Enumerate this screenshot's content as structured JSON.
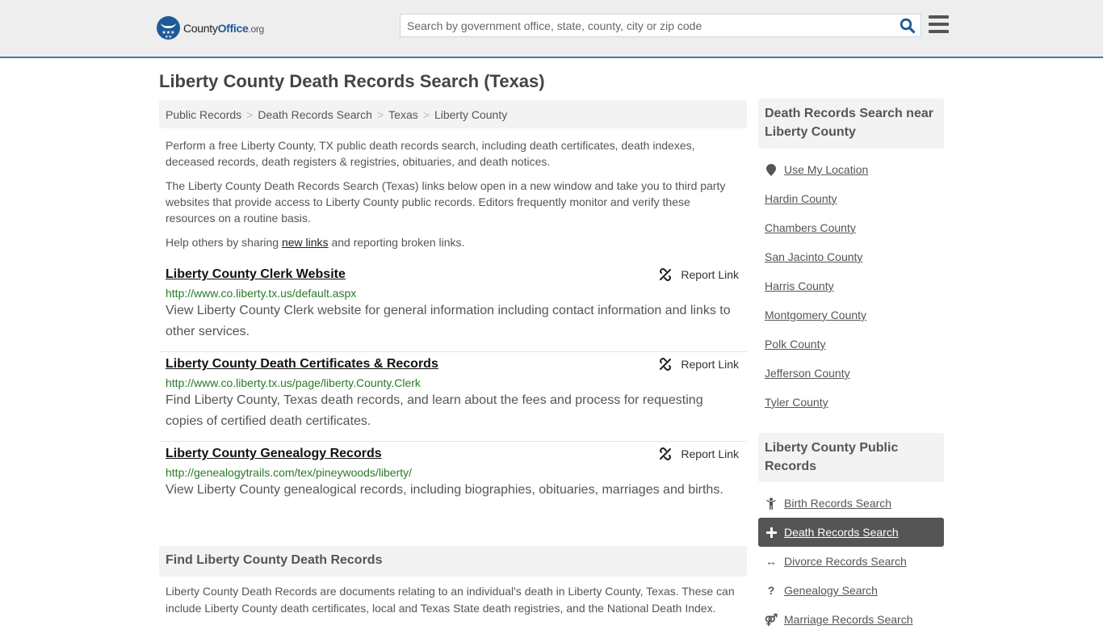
{
  "header": {
    "logo": {
      "prefix": "County",
      "brand": "Office",
      "tld": ".org"
    },
    "search": {
      "placeholder": "Search by government office, state, county, city or zip code",
      "value": ""
    },
    "colors": {
      "brand": "#1e5a99",
      "header_border": "#3a7fb0"
    }
  },
  "page": {
    "title": "Liberty County Death Records Search (Texas)",
    "breadcrumb": [
      {
        "label": "Public Records"
      },
      {
        "label": "Death Records Search"
      },
      {
        "label": "Texas"
      },
      {
        "label": "Liberty County"
      }
    ],
    "breadcrumb_separator": ">",
    "intro": {
      "p1": "Perform a free Liberty County, TX public death records search, including death certificates, death indexes, deceased records, death registers & registries, obituaries, and death notices.",
      "p2": "The Liberty County Death Records Search (Texas) links below open in a new window and take you to third party websites that provide access to Liberty County public records. Editors frequently monitor and verify these resources on a routine basis.",
      "p3_before": "Help others by sharing ",
      "p3_link": "new links",
      "p3_after": " and reporting broken links."
    },
    "links": [
      {
        "title": "Liberty County Clerk Website",
        "url": "http://www.co.liberty.tx.us/default.aspx",
        "description": "View Liberty County Clerk website for general information including contact information and links to other services.",
        "report_label": "Report Link"
      },
      {
        "title": "Liberty County Death Certificates & Records",
        "url": "http://www.co.liberty.tx.us/page/liberty.County.Clerk",
        "description": "Find Liberty County, Texas death records, and learn about the fees and process for requesting copies of certified death certificates.",
        "report_label": "Report Link"
      },
      {
        "title": "Liberty County Genealogy Records",
        "url": "http://genealogytrails.com/tex/pineywoods/liberty/",
        "description": "View Liberty County genealogical records, including biographies, obituaries, marriages and births.",
        "report_label": "Report Link"
      }
    ],
    "find_section": {
      "heading": "Find Liberty County Death Records",
      "body": "Liberty County Death Records are documents relating to an individual's death in Liberty County, Texas. These can include Liberty County death certificates, local and Texas State death registries, and the National Death Index."
    }
  },
  "sidebar": {
    "nearby": {
      "heading": "Death Records Search near Liberty County",
      "use_location": "Use My Location",
      "counties": [
        "Hardin County",
        "Chambers County",
        "San Jacinto County",
        "Harris County",
        "Montgomery County",
        "Polk County",
        "Jefferson County",
        "Tyler County"
      ]
    },
    "public_records": {
      "heading": "Liberty County Public Records",
      "items": [
        {
          "label": "Birth Records Search",
          "icon": "child-icon",
          "glyph": "Ÿ",
          "active": false
        },
        {
          "label": "Death Records Search",
          "icon": "plus-icon",
          "glyph": "+",
          "active": true
        },
        {
          "label": "Divorce Records Search",
          "icon": "arrows-horizontal-icon",
          "glyph": "↔",
          "active": false
        },
        {
          "label": "Genealogy Search",
          "icon": "question-icon",
          "glyph": "?",
          "active": false
        },
        {
          "label": "Marriage Records Search",
          "icon": "marriage-icon",
          "glyph": "⚤",
          "active": false
        }
      ]
    }
  }
}
